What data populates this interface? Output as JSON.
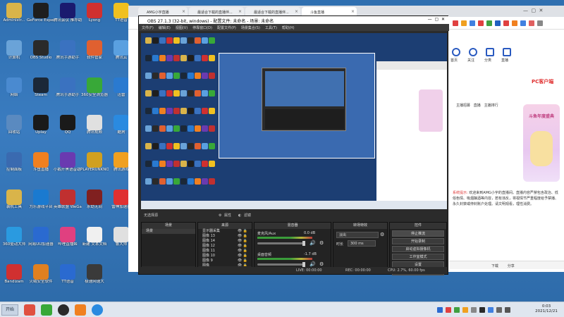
{
  "desktop": {
    "icons": [
      {
        "label": "Administr...",
        "color": "#d9b44a",
        "glyph": "folder-icon"
      },
      {
        "label": "GeForce Experience",
        "color": "#1e1e1e",
        "glyph": "nvidia-icon"
      },
      {
        "label": "腾讯会议 推荐助手",
        "color": "#1a1a6e",
        "glyph": "app-icon"
      },
      {
        "label": "Lyong",
        "color": "#d03030",
        "glyph": "app-icon"
      },
      {
        "label": "TT语音",
        "color": "#f0c020",
        "glyph": "app-icon"
      },
      {
        "label": "计算机",
        "color": "#6aa3d8",
        "glyph": "computer-icon"
      },
      {
        "label": "OBS Studio",
        "color": "#2a2a2a",
        "glyph": "obs-icon"
      },
      {
        "label": "腾讯手游助手",
        "color": "#3a72c0",
        "glyph": "app-icon"
      },
      {
        "label": "软件管家",
        "color": "#e06030",
        "glyph": "app-icon"
      },
      {
        "label": "腾讯云",
        "color": "#5aa0e0",
        "glyph": "app-icon"
      },
      {
        "label": "网络",
        "color": "#4a8ad0",
        "glyph": "network-icon"
      },
      {
        "label": "Steam",
        "color": "#1b2838",
        "glyph": "steam-icon"
      },
      {
        "label": "腾讯手游助手",
        "color": "#3a72c0",
        "glyph": "app-icon"
      },
      {
        "label": "360安全浏览器",
        "color": "#38a838",
        "glyph": "browser-icon"
      },
      {
        "label": "迅雷",
        "color": "#2a7ad0",
        "glyph": "app-icon"
      },
      {
        "label": "回收站",
        "color": "#5a8ac0",
        "glyph": "recycle-bin-icon"
      },
      {
        "label": "Uplay",
        "color": "#1a1a1a",
        "glyph": "app-icon"
      },
      {
        "label": "QQ",
        "color": "#1a1a1a",
        "glyph": "qq-icon"
      },
      {
        "label": "腾讯视频",
        "color": "#e0e0e0",
        "glyph": "app-icon"
      },
      {
        "label": "酷狗",
        "color": "#2a8ae0",
        "glyph": "app-icon"
      },
      {
        "label": "控制面板",
        "color": "#3a6ab0",
        "glyph": "control-panel-icon"
      },
      {
        "label": "斗鱼直播",
        "color": "#f08020",
        "glyph": "app-icon"
      },
      {
        "label": "小鹅开黑语音助手",
        "color": "#6a3ab0",
        "glyph": "app-icon"
      },
      {
        "label": "PLAYERUNKNOWN'S BATTLEGROUNDS",
        "color": "#d0a020",
        "glyph": "app-icon"
      },
      {
        "label": "腾讯游戏",
        "color": "#f0a020",
        "glyph": "app-icon"
      },
      {
        "label": "装机工具",
        "color": "#d9b44a",
        "glyph": "folder-icon"
      },
      {
        "label": "为乐游戏平台",
        "color": "#1a7ad0",
        "glyph": "app-icon"
      },
      {
        "label": "英雄联盟 WeGame",
        "color": "#c03030",
        "glyph": "app-icon"
      },
      {
        "label": "永劫无间",
        "color": "#802020",
        "glyph": "app-icon"
      },
      {
        "label": "雷神加速器",
        "color": "#e03030",
        "glyph": "app-icon"
      },
      {
        "label": "360驱动大师",
        "color": "#2a9ae0",
        "glyph": "app-icon"
      },
      {
        "label": "网易UU加速器",
        "color": "#2a6ad0",
        "glyph": "app-icon"
      },
      {
        "label": "哔哩直播姬",
        "color": "#e04080",
        "glyph": "app-icon"
      },
      {
        "label": "新建 文本文档",
        "color": "#f0f0f0",
        "glyph": "document-icon"
      },
      {
        "label": "鲁大师",
        "color": "#e0e0e0",
        "glyph": "app-icon"
      },
      {
        "label": "Bandizam",
        "color": "#d03030",
        "glyph": "app-icon"
      },
      {
        "label": "火绒安全软件",
        "color": "#e08020",
        "glyph": "app-icon"
      },
      {
        "label": "TT语音",
        "color": "#2a6ad0",
        "glyph": "app-icon"
      },
      {
        "label": "极速网速大",
        "color": "#3a3a3a",
        "glyph": "app-icon"
      }
    ]
  },
  "browser": {
    "tabs": [
      {
        "label": "AMG小宇直播",
        "active": false
      },
      {
        "label": "最适合下载的直播伴...",
        "active": false
      },
      {
        "label": "最适合下载的直播伴...",
        "active": false
      },
      {
        "label": "斗鱼直播",
        "active": true
      }
    ],
    "right_nav": [
      "首页",
      "关注",
      "分类",
      "直播"
    ],
    "pc_client": "PC客户端",
    "section_tabs": [
      "主播招募",
      "直播",
      "主播排行"
    ],
    "notice_label": "系统提示:",
    "notice_text": "欢迎来到AMG小宇的直播间。直播内容严禁包含政治、低俗色情、吸烟酗酒等内容，若有违反，将视情节严重程度给予禁播、永久封禁或停封账户处理。请文明观看，理性消费。",
    "bottom_bar": [
      "下载",
      "分享"
    ],
    "promo": "斗鱼年度盛典"
  },
  "obs": {
    "title": "OBS 27.1.3 (32-bit, windows) - 配置文件: 未命名 - 场景: 未命名",
    "menu": [
      "文件(F)",
      "编辑(E)",
      "视图(V)",
      "停靠窗口(D)",
      "配置文件(P)",
      "场景集合(S)",
      "工具(T)",
      "帮助(H)"
    ],
    "no_source": "无选择源",
    "props": "属性",
    "filters": "滤镜",
    "panels": {
      "scenes": "场景",
      "sources": "来源",
      "mixer": "混音器",
      "transitions": "转场特效",
      "controls": "控件"
    },
    "scene_items": [
      "场景"
    ],
    "source_items": [
      "显示器采集",
      "图像 13",
      "图像 14",
      "图像 12",
      "图像 11",
      "图像 10",
      "图像 9",
      "图像"
    ],
    "mixer": [
      {
        "name": "麦克风/Aux",
        "db": "0.0 dB"
      },
      {
        "name": "桌面音频",
        "db": "-1.7 dB"
      }
    ],
    "transition": {
      "type": "淡出",
      "duration_label": "时长",
      "duration": "300 ms"
    },
    "controls": [
      "停止推流",
      "开始录制",
      "启动虚拟摄像机",
      "工作室模式",
      "设置",
      "退出"
    ],
    "status": {
      "live": "LIVE: 00:00:00",
      "rec": "REC: 00:00:00",
      "cpu": "CPU: 2.7%, 60.00 fps"
    }
  },
  "taskbar": {
    "start": "开始",
    "time": "0:03",
    "date": "2021/12/21"
  }
}
